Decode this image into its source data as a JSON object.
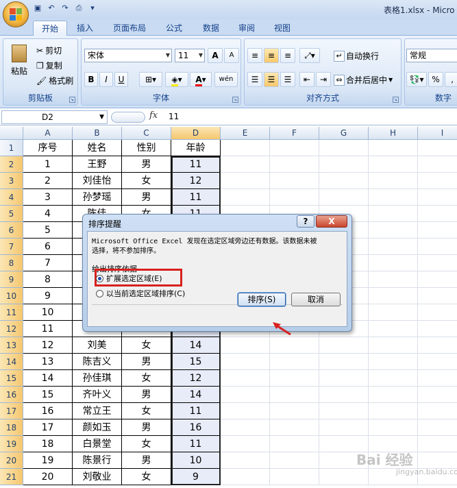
{
  "window": {
    "title": "表格1.xlsx - Micro"
  },
  "tabs": [
    "开始",
    "插入",
    "页面布局",
    "公式",
    "数据",
    "审阅",
    "视图"
  ],
  "ribbon": {
    "clipboard": {
      "label": "剪贴板",
      "paste": "粘贴",
      "cut": "剪切",
      "copy": "复制",
      "format_painter": "格式刷"
    },
    "font": {
      "label": "字体",
      "name": "宋体",
      "size": "11",
      "grow": "A",
      "shrink": "A",
      "bold": "B",
      "italic": "I",
      "underline": "U",
      "phonetic": "wén"
    },
    "alignment": {
      "label": "对齐方式",
      "wrap": "自动换行",
      "merge": "合并后居中"
    },
    "number": {
      "label": "数字",
      "format": "常规",
      "percent": "%"
    }
  },
  "formula_bar": {
    "name_box": "D2",
    "fx": "fx",
    "value": "11"
  },
  "grid": {
    "columns": [
      "A",
      "B",
      "C",
      "D",
      "E",
      "F",
      "G",
      "H",
      "I"
    ],
    "selected_column": "D",
    "rows": [
      [
        "序号",
        "姓名",
        "性别",
        "年龄"
      ],
      [
        "1",
        "王野",
        "男",
        "11"
      ],
      [
        "2",
        "刘佳怡",
        "女",
        "12"
      ],
      [
        "3",
        "孙梦瑶",
        "男",
        "11"
      ],
      [
        "4",
        "陈佳",
        "女",
        "11"
      ],
      [
        "5",
        "",
        "",
        ""
      ],
      [
        "6",
        "",
        "",
        ""
      ],
      [
        "7",
        "",
        "",
        ""
      ],
      [
        "8",
        "",
        "",
        ""
      ],
      [
        "9",
        "",
        "",
        ""
      ],
      [
        "10",
        "",
        "",
        ""
      ],
      [
        "11",
        "",
        "",
        ""
      ],
      [
        "12",
        "刘美",
        "女",
        "14"
      ],
      [
        "13",
        "陈吉义",
        "男",
        "15"
      ],
      [
        "14",
        "孙佳琪",
        "女",
        "12"
      ],
      [
        "15",
        "齐叶义",
        "男",
        "14"
      ],
      [
        "16",
        "常立王",
        "女",
        "11"
      ],
      [
        "17",
        "颜如玉",
        "男",
        "16"
      ],
      [
        "18",
        "白景堂",
        "女",
        "11"
      ],
      [
        "19",
        "陈景行",
        "男",
        "10"
      ],
      [
        "20",
        "刘敬业",
        "女",
        "9"
      ]
    ]
  },
  "dialog": {
    "title": "排序提醒",
    "help": "?",
    "close": "X",
    "message_line1": "Microsoft Office Excel 发现在选定区域旁边还有数据。该数据未被",
    "message_line2": "选择，将不参加排序。",
    "group_label": "给出排序依据",
    "option_expand": "扩展选定区域(E)",
    "option_current": "以当前选定区域排序(C)",
    "sort_button": "排序(S)",
    "cancel_button": "取消"
  },
  "watermark": {
    "text": "Bai 经验",
    "sub": "jingyan.baidu.com"
  },
  "colors": {
    "highlight": "#d8201c",
    "selection": "#e8ecf8",
    "ribbon": "#d3e2f5"
  }
}
